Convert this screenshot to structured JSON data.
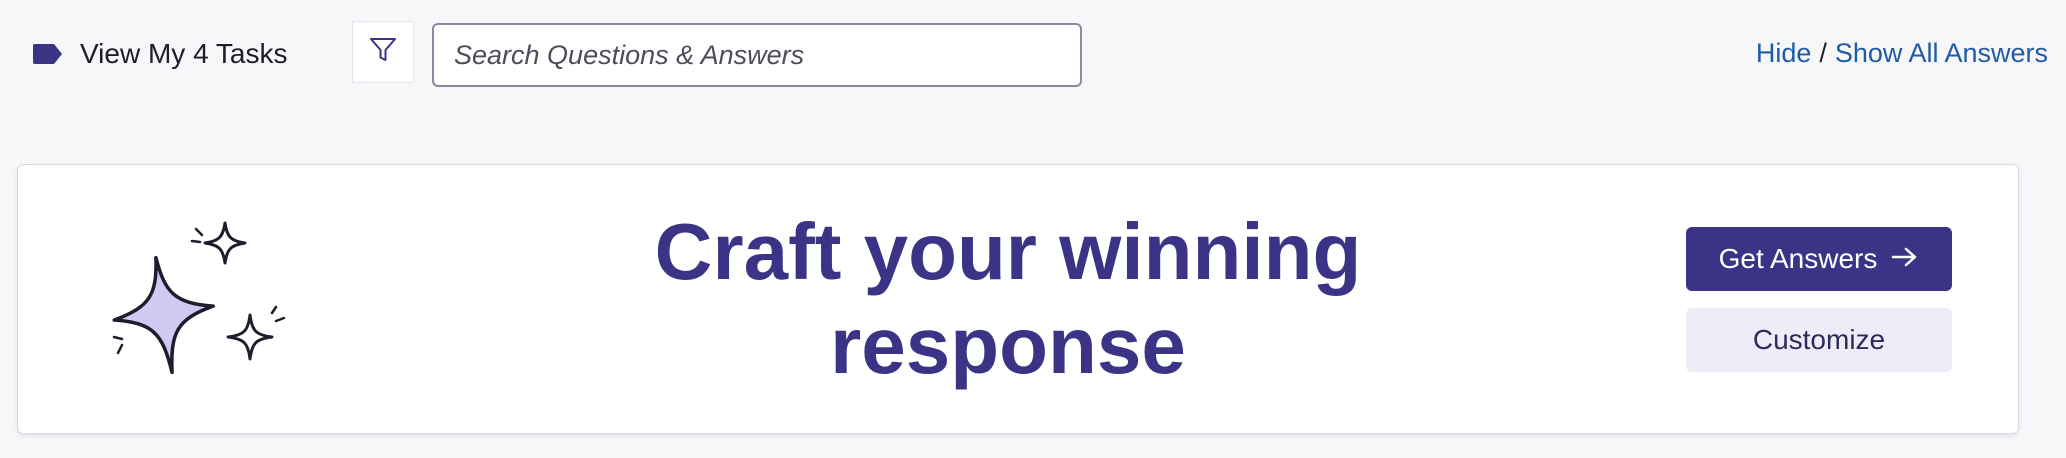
{
  "toolbar": {
    "tasks_label": "View My 4 Tasks",
    "tasks_icon": "tag-icon",
    "filter_icon": "filter-icon",
    "search": {
      "placeholder": "Search Questions & Answers",
      "value": ""
    },
    "hide_label": "Hide",
    "separator": "/",
    "show_all_label": "Show All Answers"
  },
  "promo": {
    "illustration": "sparkles-icon",
    "headline": "Craft your winning response",
    "primary_button": "Get Answers",
    "primary_button_icon": "arrow-right-icon",
    "secondary_button": "Customize"
  },
  "colors": {
    "page_background": "#f7f7f9",
    "brand_primary": "#3b3486",
    "link": "#1f5aa6",
    "sparkle_fill": "#cfcaf2",
    "secondary_button_bg": "#eeedf7"
  }
}
